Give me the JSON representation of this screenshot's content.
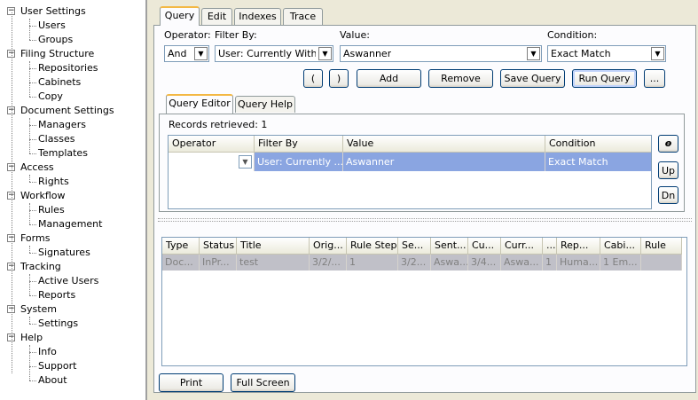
{
  "tree": [
    {
      "label": "User Settings",
      "children": [
        "Users",
        "Groups"
      ]
    },
    {
      "label": "Filing Structure",
      "children": [
        "Repositories",
        "Cabinets",
        "Copy"
      ]
    },
    {
      "label": "Document Settings",
      "children": [
        "Managers",
        "Classes",
        "Templates"
      ]
    },
    {
      "label": "Access",
      "children": [
        "Rights"
      ]
    },
    {
      "label": "Workflow",
      "children": [
        "Rules",
        "Management"
      ]
    },
    {
      "label": "Forms",
      "children": [
        "Signatures"
      ]
    },
    {
      "label": "Tracking",
      "children": [
        "Active Users",
        "Reports"
      ]
    },
    {
      "label": "System",
      "children": [
        "Settings"
      ]
    },
    {
      "label": "Help",
      "children": [
        "Info",
        "Support",
        "About"
      ]
    }
  ],
  "tabs": [
    "Query",
    "Edit",
    "Indexes",
    "Trace"
  ],
  "filters": {
    "operator_label": "Operator:",
    "operator_value": "And",
    "filterby_label": "Filter By:",
    "filterby_value": "User: Currently With",
    "value_label": "Value:",
    "value_value": "Aswanner",
    "condition_label": "Condition:",
    "condition_value": "Exact Match"
  },
  "buttons": {
    "open_paren": "(",
    "close_paren": ")",
    "add": "Add",
    "remove": "Remove",
    "save_query": "Save Query",
    "run_query": "Run Query",
    "more": "...",
    "up": "Up",
    "dn": "Dn",
    "print": "Print",
    "full_screen": "Full Screen"
  },
  "subtabs": [
    "Query Editor",
    "Query Help"
  ],
  "records_retrieved": "Records retrieved: 1",
  "query_grid": {
    "columns": [
      "Operator",
      "Filter By",
      "Value",
      "Condition"
    ],
    "row": {
      "operator": "",
      "filter_by": "User: Currently ...",
      "value": "Aswanner",
      "condition": "Exact Match"
    }
  },
  "results_grid": {
    "columns": [
      "Type",
      "Status",
      "Title",
      "Orig...",
      "Rule Step",
      "Se...",
      "Sent...",
      "Cu...",
      "Curr...",
      "...",
      "Rep...",
      "Cabi...",
      "Rule"
    ],
    "row": [
      "Doc...",
      "InPr...",
      "test",
      "3/2/...",
      "1",
      "3/2...",
      "Aswa...",
      "3/4...",
      "Aswa...",
      "1",
      "Huma...",
      "1 Em...",
      ""
    ]
  },
  "icons": {
    "eraser": "eraser-icon",
    "expander": "minus-box-icon",
    "dropdown": "chevron-down-icon"
  },
  "colors": {
    "selected_row": "#8aa5e1",
    "active_tab_accent": "#f3b844"
  }
}
